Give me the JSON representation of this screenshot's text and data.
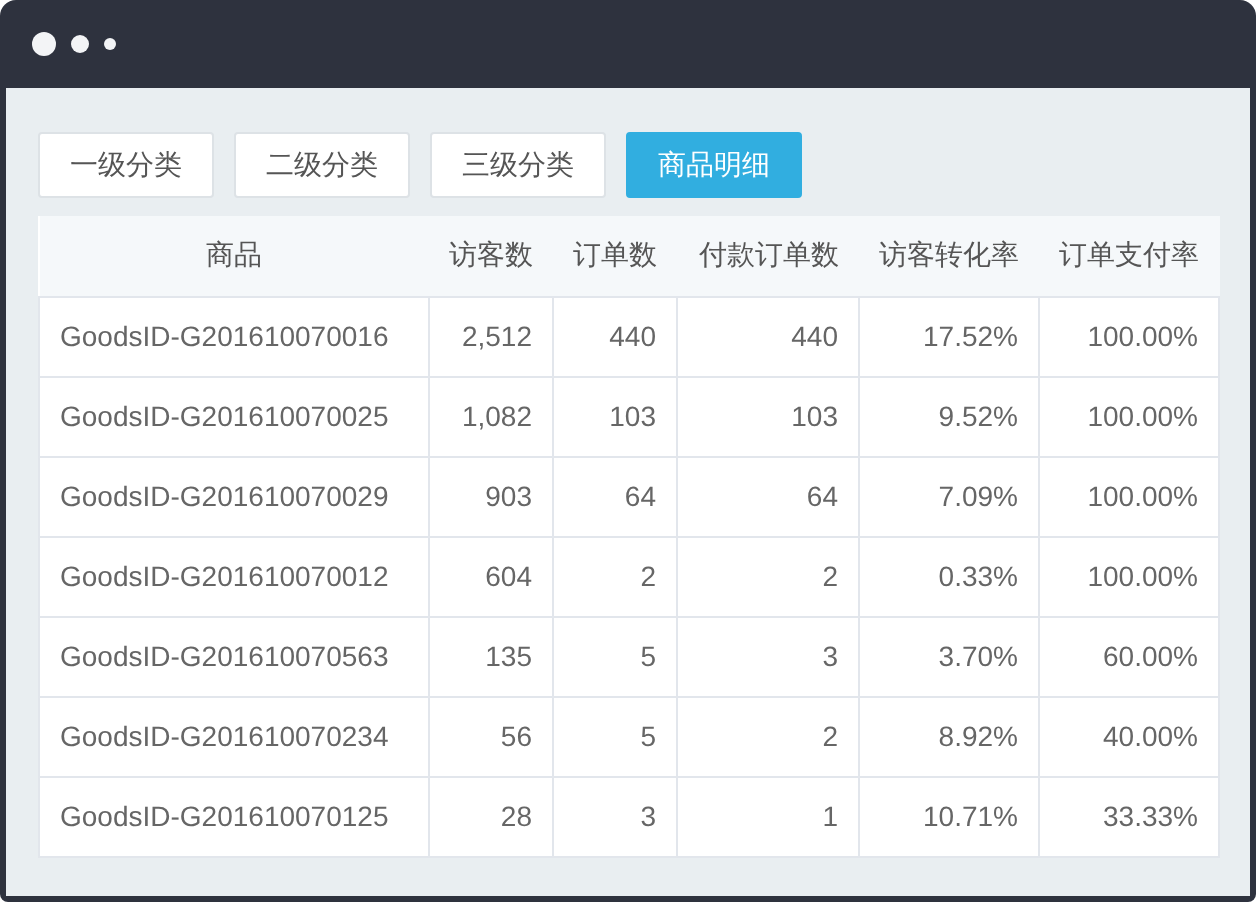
{
  "tabs": [
    {
      "label": "一级分类",
      "selected": false
    },
    {
      "label": "二级分类",
      "selected": false
    },
    {
      "label": "三级分类",
      "selected": false
    },
    {
      "label": "商品明细",
      "selected": true
    }
  ],
  "table": {
    "columns": [
      "商品",
      "访客数",
      "订单数",
      "付款订单数",
      "访客转化率",
      "订单支付率"
    ],
    "rows": [
      [
        "GoodsID-G201610070016",
        "2,512",
        "440",
        "440",
        "17.52%",
        "100.00%"
      ],
      [
        "GoodsID-G201610070025",
        "1,082",
        "103",
        "103",
        "9.52%",
        "100.00%"
      ],
      [
        "GoodsID-G201610070029",
        "903",
        "64",
        "64",
        "7.09%",
        "100.00%"
      ],
      [
        "GoodsID-G201610070012",
        "604",
        "2",
        "2",
        "0.33%",
        "100.00%"
      ],
      [
        "GoodsID-G201610070563",
        "135",
        "5",
        "3",
        "3.70%",
        "60.00%"
      ],
      [
        "GoodsID-G201610070234",
        "56",
        "5",
        "2",
        "8.92%",
        "40.00%"
      ],
      [
        "GoodsID-G201610070125",
        "28",
        "3",
        "1",
        "10.71%",
        "33.33%"
      ]
    ]
  }
}
